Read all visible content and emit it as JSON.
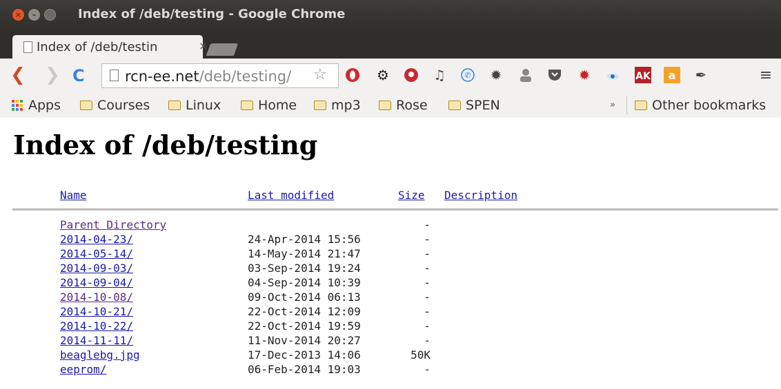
{
  "window": {
    "title": "Index of /deb/testing - Google Chrome"
  },
  "tab": {
    "title": "Index of /deb/testin",
    "close": "×"
  },
  "toolbar": {
    "url_host": "rcn-ee.net",
    "url_path": "/deb/testing/",
    "menu_glyph": "≡"
  },
  "extensions": [
    "opera-icon",
    "gear-icon",
    "pocket-red-icon",
    "music-note-icon",
    "phone-icon",
    "bug-icon",
    "person-icon",
    "pocket-shield-icon",
    "red-gear-icon",
    "eye-icon",
    "ak-icon",
    "amazon-icon",
    "pen-icon"
  ],
  "bookmarks": {
    "apps": "Apps",
    "folders": [
      "Courses",
      "Linux",
      "Home",
      "mp3",
      "Rose",
      "SPEN"
    ],
    "overflow": "»",
    "other": "Other bookmarks"
  },
  "page": {
    "heading": "Index of /deb/testing",
    "columns": {
      "name": "Name",
      "modified": "Last modified",
      "size": "Size",
      "description": "Description"
    },
    "rows": [
      {
        "name": "Parent Directory",
        "modified": "",
        "size": "-"
      },
      {
        "name": "2014-04-23/",
        "modified": "24-Apr-2014 15:56",
        "size": "-"
      },
      {
        "name": "2014-05-14/",
        "modified": "14-May-2014 21:47",
        "size": "-"
      },
      {
        "name": "2014-09-03/",
        "modified": "03-Sep-2014 19:24",
        "size": "-"
      },
      {
        "name": "2014-09-04/",
        "modified": "04-Sep-2014 10:39",
        "size": "-"
      },
      {
        "name": "2014-10-08/",
        "modified": "09-Oct-2014 06:13",
        "size": "-"
      },
      {
        "name": "2014-10-21/",
        "modified": "22-Oct-2014 12:09",
        "size": "-"
      },
      {
        "name": "2014-10-22/",
        "modified": "22-Oct-2014 19:59",
        "size": "-"
      },
      {
        "name": "2014-11-11/",
        "modified": "11-Nov-2014 20:27",
        "size": "-"
      },
      {
        "name": "beaglebg.jpg",
        "modified": "17-Dec-2013 14:06",
        "size": "50K"
      },
      {
        "name": "eeprom/",
        "modified": "06-Feb-2014 19:03",
        "size": "-"
      }
    ]
  },
  "colors": {
    "link": "#1a1aa6",
    "visited": "#5b2a86",
    "close_button": "#e2562a"
  }
}
